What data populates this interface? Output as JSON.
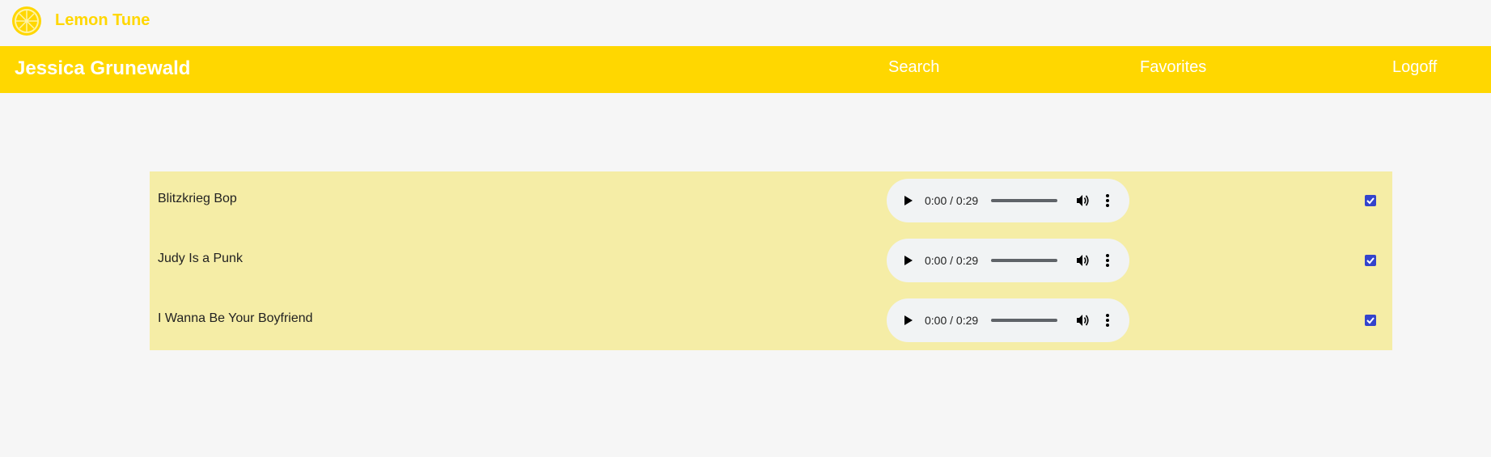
{
  "app": {
    "title": "Lemon Tune",
    "logo_icon": "lemon-icon",
    "accent_color": "#ffd700"
  },
  "navbar": {
    "user_name": "Jessica Grunewald",
    "links": {
      "search": "Search",
      "favorites": "Favorites",
      "logoff": "Logoff"
    }
  },
  "songs": [
    {
      "title": "Blitzkrieg Bop",
      "time": "0:00 / 0:29",
      "progress": 0,
      "favorite": true
    },
    {
      "title": "Judy Is a Punk",
      "time": "0:00 / 0:29",
      "progress": 0,
      "favorite": true
    },
    {
      "title": "I Wanna Be Your Boyfriend",
      "time": "0:00 / 0:29",
      "progress": 0,
      "favorite": true
    }
  ],
  "colors": {
    "list_background": "#f5eda6",
    "checkbox": "#3344cc"
  }
}
